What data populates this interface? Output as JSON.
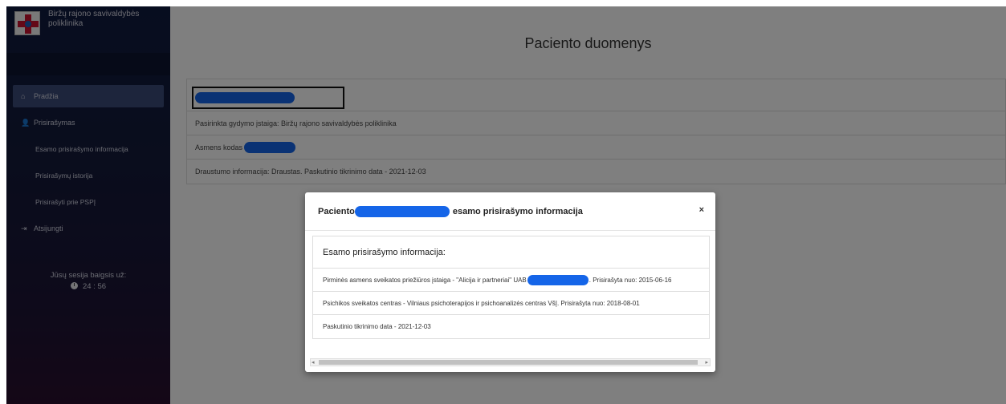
{
  "sidebar": {
    "brand_name": "Biržų rajono savivaldybės poliklinika",
    "items": [
      {
        "label": "Pradžia",
        "icon": "home-icon"
      },
      {
        "label": "Prisirašymas",
        "icon": "user-plus-icon"
      },
      {
        "label": "Esamo prisirašymo informacija"
      },
      {
        "label": "Prisirašymų istorija"
      },
      {
        "label": "Prisirašyti prie PSPĮ"
      },
      {
        "label": "Atsijungti",
        "icon": "sign-out-icon"
      }
    ],
    "session_label": "Jūsų sesija baigsis už:",
    "session_timer": "24 : 56"
  },
  "main": {
    "title": "Paciento duomenys",
    "rows": [
      {
        "text": "Pasirinkta gydymo įstaiga: Biržų rajono savivaldybės poliklinika"
      },
      {
        "label": "Asmens kodas"
      },
      {
        "text": "Draustumo informacija: Draustas. Paskutinio tikrinimo data - 2021-12-03"
      }
    ]
  },
  "modal": {
    "title_prefix": "Paciento",
    "title_suffix": "esamo prisirašymo informacija",
    "close": "×",
    "panel_heading": "Esamo prisirašymo informacija:",
    "rows": [
      {
        "prefix": "Pirminės asmens sveikatos priežiūros įstaiga - \"Alicija ir partneriai\" UAB",
        "suffix": ". Prisirašyta nuo: 2015-06-16"
      },
      {
        "text": "Psichikos sveikatos centras - Vilniaus psichoterapijos ir psichoanalizės centras VšĮ. Prisirašyta nuo: 2018-08-01"
      },
      {
        "text": "Paskutinio tikrinimo data - 2021-12-03"
      }
    ]
  },
  "colors": {
    "sidebar_top": "#0f1a3f",
    "sidebar_bottom": "#2a0f2e",
    "active_item": "#3b4a78",
    "redaction": "#1565e8"
  }
}
